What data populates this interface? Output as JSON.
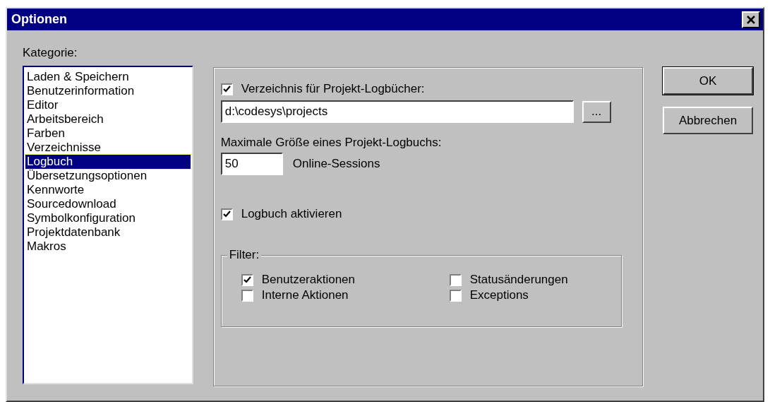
{
  "window": {
    "title": "Optionen"
  },
  "category_label": "Kategorie:",
  "categories": [
    {
      "label": "Laden & Speichern",
      "selected": false
    },
    {
      "label": "Benutzerinformation",
      "selected": false
    },
    {
      "label": "Editor",
      "selected": false
    },
    {
      "label": "Arbeitsbereich",
      "selected": false
    },
    {
      "label": "Farben",
      "selected": false
    },
    {
      "label": "Verzeichnisse",
      "selected": false
    },
    {
      "label": "Logbuch",
      "selected": true
    },
    {
      "label": "Übersetzungsoptionen",
      "selected": false
    },
    {
      "label": "Kennworte",
      "selected": false
    },
    {
      "label": "Sourcedownload",
      "selected": false
    },
    {
      "label": "Symbolkonfiguration",
      "selected": false
    },
    {
      "label": "Projektdatenbank",
      "selected": false
    },
    {
      "label": "Makros",
      "selected": false
    }
  ],
  "directory": {
    "label": "Verzeichnis für Projekt-Logbücher:",
    "checked": true,
    "value": "d:\\codesys\\projects",
    "browse": "..."
  },
  "max_size": {
    "label": "Maximale Größe eines Projekt-Logbuchs:",
    "value": "50",
    "unit": "Online-Sessions"
  },
  "enable": {
    "label": "Logbuch aktivieren",
    "checked": true
  },
  "filter": {
    "title": "Filter:",
    "options": [
      {
        "label": "Benutzeraktionen",
        "checked": true
      },
      {
        "label": "Statusänderungen",
        "checked": false
      },
      {
        "label": "Interne Aktionen",
        "checked": false
      },
      {
        "label": "Exceptions",
        "checked": false
      }
    ]
  },
  "buttons": [
    {
      "label": "OK",
      "default": true
    },
    {
      "label": "Abbrechen",
      "default": false
    }
  ]
}
